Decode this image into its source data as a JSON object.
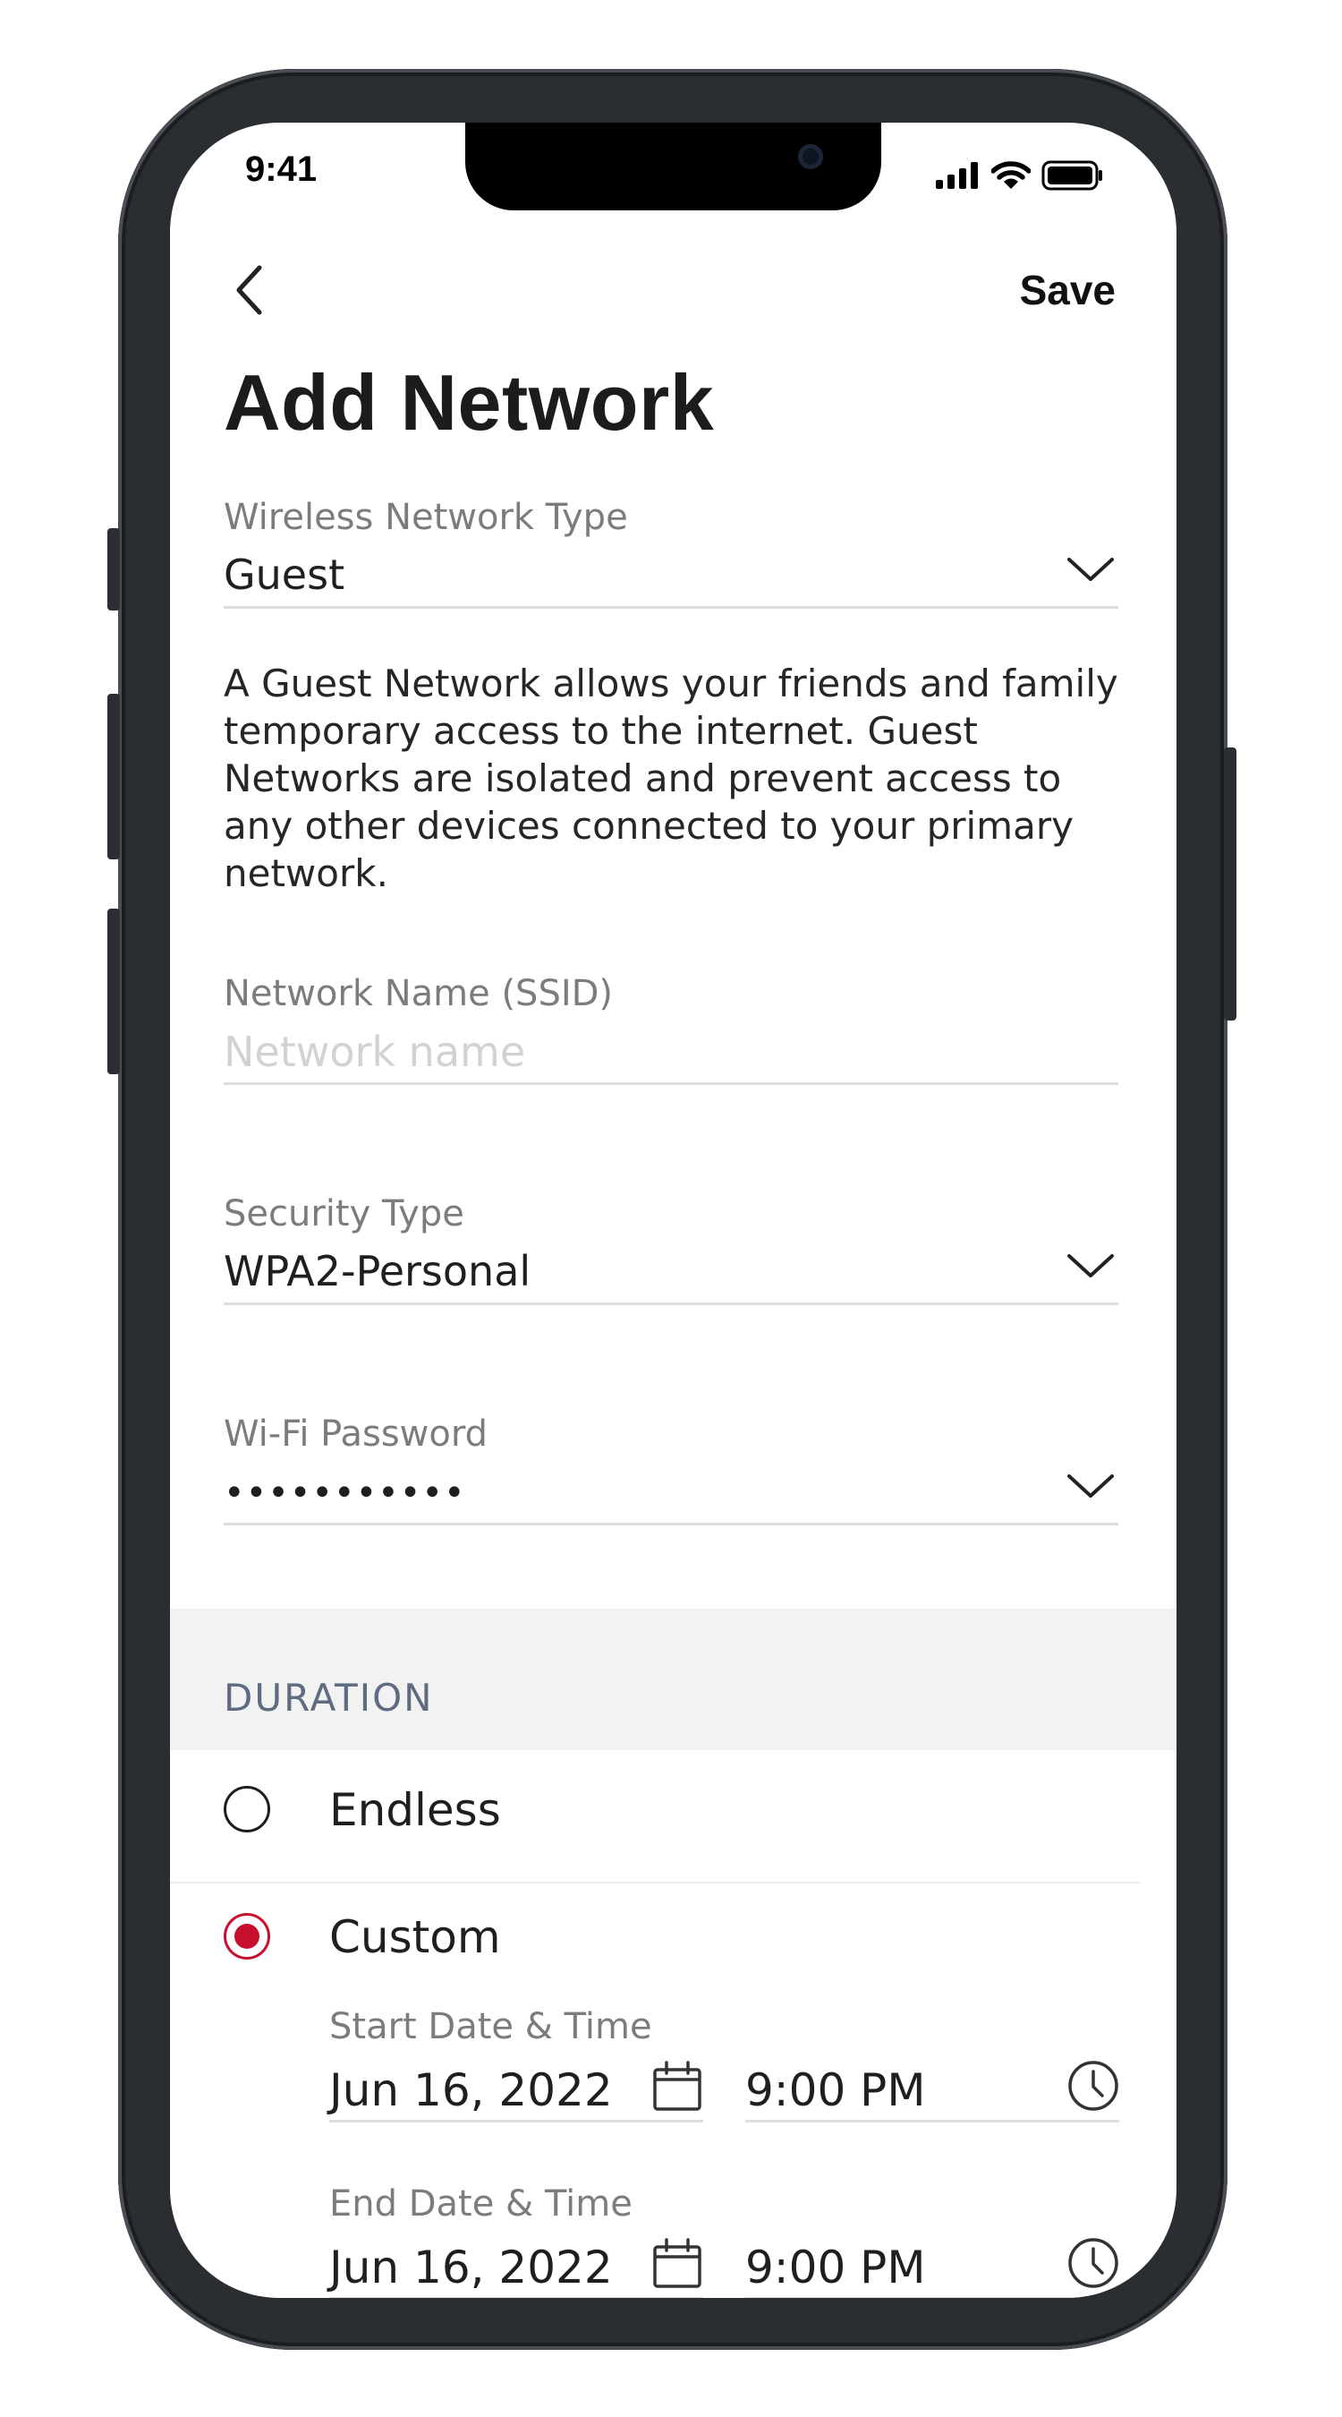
{
  "status_bar": {
    "time": "9:41"
  },
  "nav": {
    "save_label": "Save"
  },
  "page": {
    "title": "Add Network"
  },
  "form": {
    "network_type": {
      "label": "Wireless Network Type",
      "value": "Guest"
    },
    "description": "A Guest Network allows your friends and family temporary access to the internet. Guest Networks are isolated and prevent access to any other devices connected to your primary network.",
    "ssid": {
      "label": "Network Name (SSID)",
      "placeholder": "Network name",
      "value": ""
    },
    "security_type": {
      "label": "Security Type",
      "value": "WPA2-Personal"
    },
    "password": {
      "label": "Wi-Fi Password",
      "value": "•••••••••••"
    }
  },
  "duration": {
    "title": "DURATION",
    "options": [
      {
        "label": "Endless",
        "selected": false
      },
      {
        "label": "Custom",
        "selected": true
      }
    ],
    "start": {
      "label": "Start Date & Time",
      "date": "Jun 16, 2022",
      "time": "9:00 PM"
    },
    "end": {
      "label": "End Date & Time",
      "date": "Jun 16, 2022",
      "time": "9:00 PM"
    }
  },
  "colors": {
    "accent": "#c8102e",
    "section_bg": "#f2f2f2",
    "section_title": "#5e6b80"
  }
}
